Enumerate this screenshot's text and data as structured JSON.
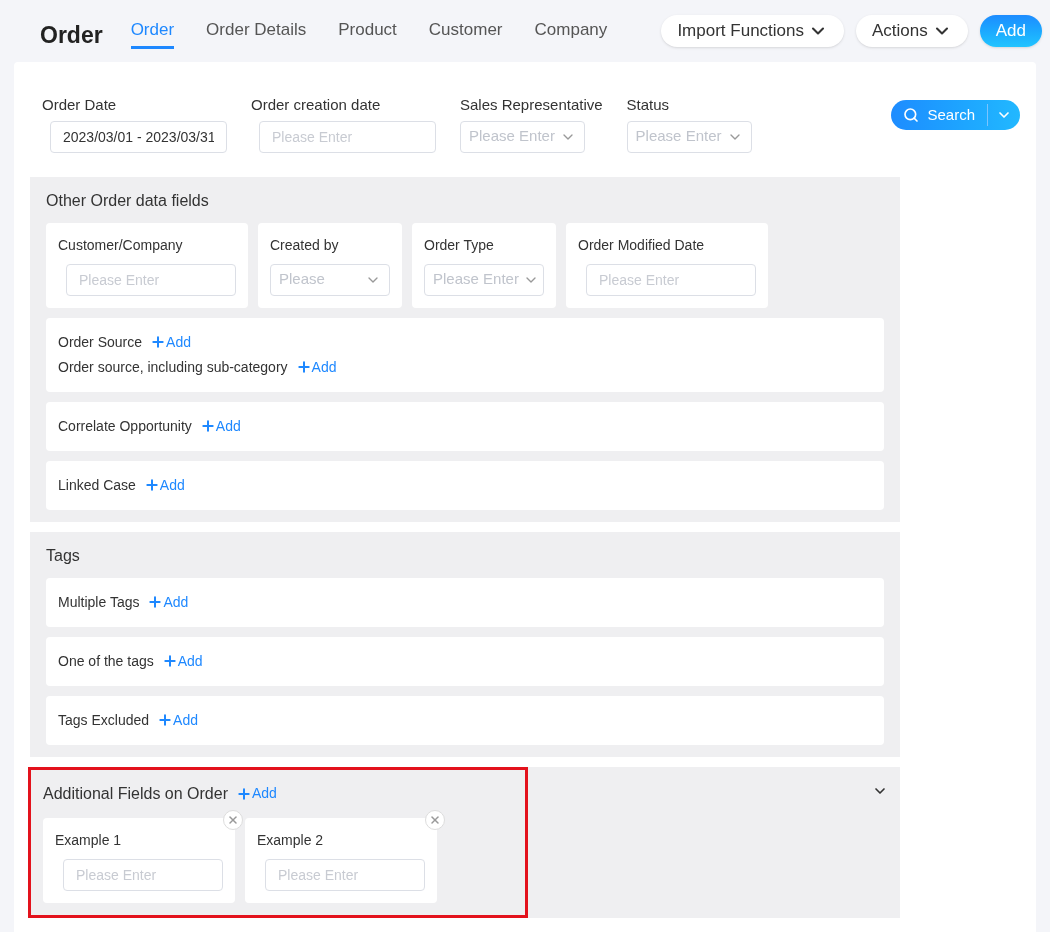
{
  "title": "Order",
  "tabs": [
    {
      "label": "Order",
      "selected": true
    },
    {
      "label": "Order Details",
      "selected": false
    },
    {
      "label": "Product",
      "selected": false
    },
    {
      "label": "Customer",
      "selected": false
    },
    {
      "label": "Company",
      "selected": false
    }
  ],
  "header_buttons": [
    {
      "label": "Import Functions",
      "kind": "menu"
    },
    {
      "label": "Actions",
      "kind": "menu"
    },
    {
      "label": "Add",
      "kind": "primary"
    }
  ],
  "filters": [
    {
      "label": "Order Date",
      "kind": "input",
      "value": "2023/03/01 - 2023/03/31"
    },
    {
      "label": "Order creation date",
      "kind": "input",
      "placeholder": "Please Enter"
    },
    {
      "label": "Sales Representative",
      "kind": "select",
      "placeholder": "Please Enter"
    },
    {
      "label": "Status",
      "kind": "select",
      "placeholder": "Please Enter"
    }
  ],
  "search_button": "Search",
  "sections": [
    {
      "title": "Other Order data fields",
      "fields": [
        {
          "label": "Customer/Company",
          "kind": "input",
          "placeholder": "Please Enter"
        },
        {
          "label": "Created by",
          "kind": "select",
          "placeholder": "Please"
        },
        {
          "label": "Order Type",
          "kind": "select",
          "placeholder": "Please Enter"
        },
        {
          "label": "Order Modified Date",
          "kind": "input",
          "placeholder": "Please Enter"
        }
      ],
      "rows": [
        [
          {
            "label": "Order Source",
            "add": "Add"
          },
          {
            "label": "Order source, including sub-category",
            "add": "Add"
          }
        ],
        [
          {
            "label": "Correlate Opportunity",
            "add": "Add"
          }
        ],
        [
          {
            "label": "Linked Case",
            "add": "Add"
          }
        ]
      ]
    },
    {
      "title": "Tags",
      "rows": [
        [
          {
            "label": "Multiple Tags",
            "add": "Add"
          }
        ],
        [
          {
            "label": "One of the tags",
            "add": "Add"
          }
        ],
        [
          {
            "label": "Tags Excluded",
            "add": "Add"
          }
        ]
      ]
    }
  ],
  "additional": {
    "title": "Additional Fields on Order",
    "add": "Add",
    "highlighted": true,
    "fields": [
      {
        "label": "Example 1",
        "placeholder": "Please Enter"
      },
      {
        "label": "Example 2",
        "placeholder": "Please Enter"
      }
    ]
  }
}
